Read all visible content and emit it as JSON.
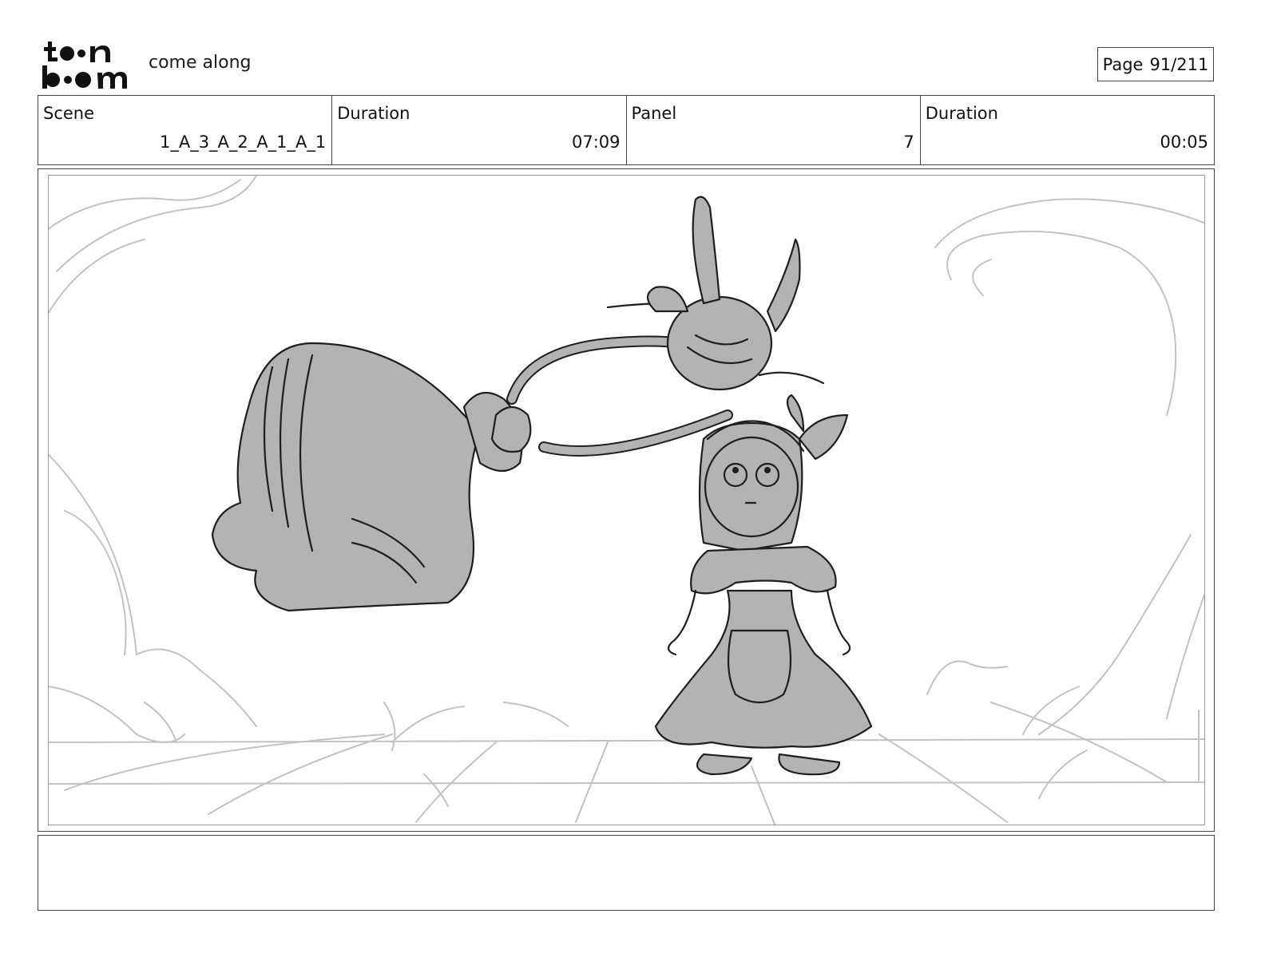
{
  "header": {
    "logo_lines": [
      "toon",
      "boom"
    ],
    "project_title": "come along",
    "page_label": "Page",
    "page_number": "91/211"
  },
  "info": {
    "scene_label": "Scene",
    "scene_value": "1_A_3_A_2_A_1_A_1",
    "scene_duration_label": "Duration",
    "scene_duration_value": "07:09",
    "panel_label": "Panel",
    "panel_value": "7",
    "panel_duration_label": "Duration",
    "panel_duration_value": "00:05"
  },
  "panel": {
    "sketch_colors": {
      "fill": "#b3b3b3",
      "line": "#1e1e1e",
      "background": "#bdbdbd"
    }
  },
  "caption": {
    "text": ""
  }
}
